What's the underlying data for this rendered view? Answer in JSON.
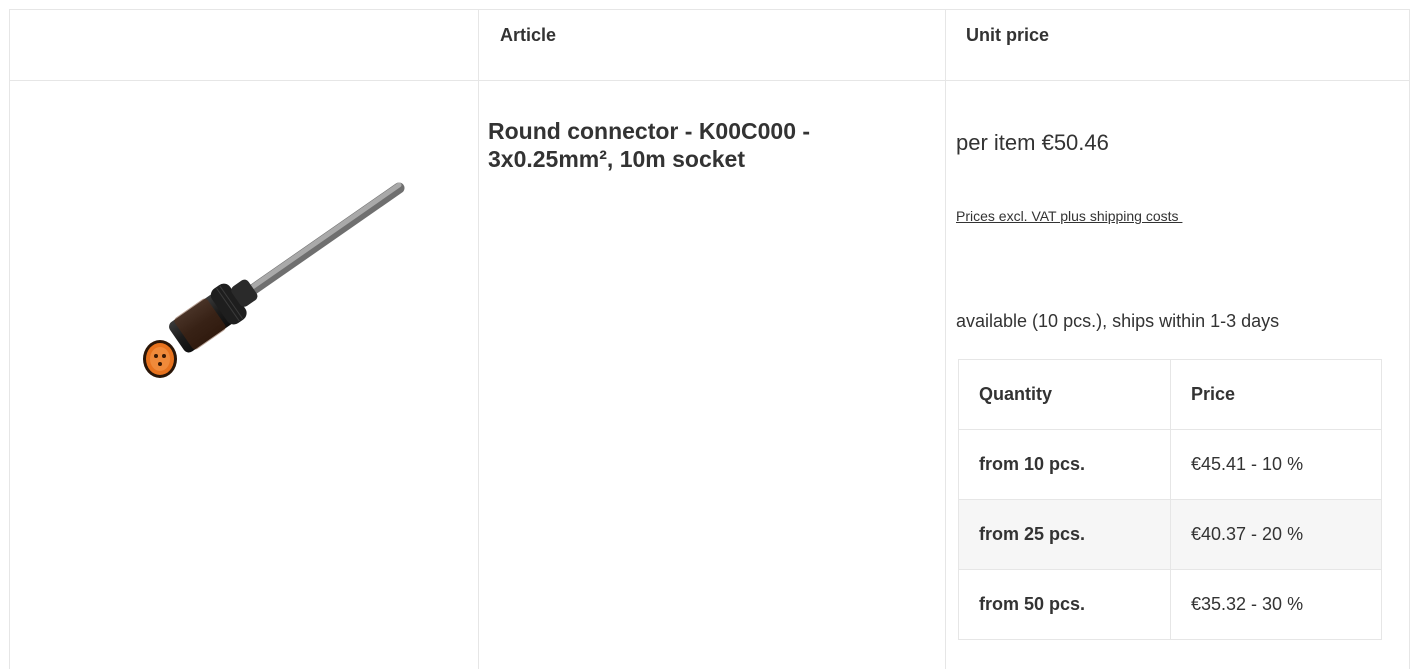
{
  "table_headers": {
    "article": "Article",
    "unit_price": "Unit price"
  },
  "product": {
    "title": "Round connector - K00C000 - 3x0.25mm², 10m socket",
    "unit_price": "per item €50.46",
    "vat_note": "Prices excl. VAT plus shipping costs ",
    "availability": "available (10 pcs.), ships within 1-3 days",
    "image_icon": "cable-connector-image"
  },
  "tiers": {
    "headers": {
      "quantity": "Quantity",
      "price": "Price"
    },
    "rows": [
      {
        "quantity": "from 10 pcs.",
        "price": "€45.41 - 10 %"
      },
      {
        "quantity": "from 25 pcs.",
        "price": "€40.37 - 20 %"
      },
      {
        "quantity": "from 50 pcs.",
        "price": "€35.32 - 30 %"
      }
    ]
  },
  "colors": {
    "border": "#e6e6e6",
    "text": "#333333",
    "alt_row": "#f6f6f6",
    "connector_orange": "#e8731e"
  }
}
